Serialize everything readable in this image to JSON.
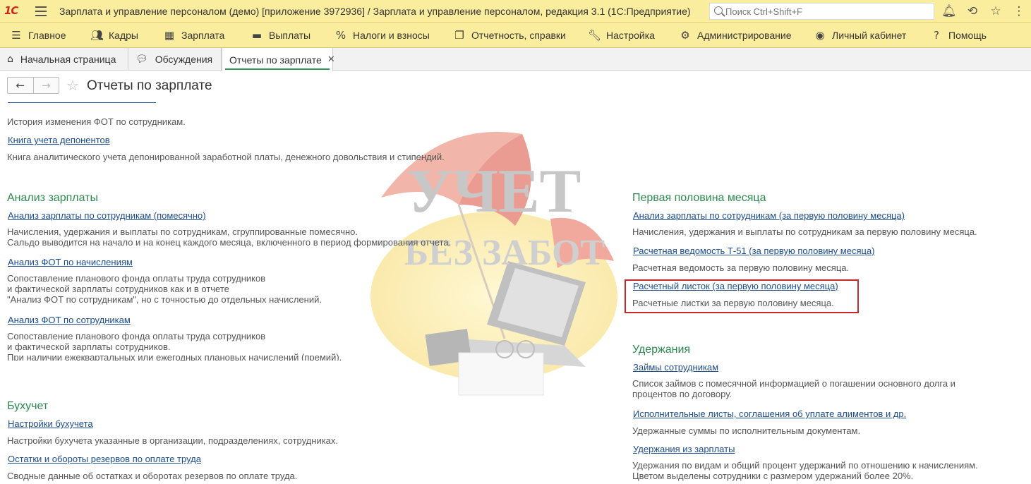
{
  "titlebar": {
    "app_title": "Зарплата и управление персоналом (демо) [приложение 3972936] / Зарплата и управление персоналом, редакция 3.1  (1С:Предприятие)",
    "search_placeholder": "Поиск Ctrl+Shift+F",
    "logo": "1С"
  },
  "menu": [
    {
      "label": "Главное",
      "icon": "hamburger-icon"
    },
    {
      "label": "Кадры",
      "icon": "people-icon"
    },
    {
      "label": "Зарплата",
      "icon": "calculator-icon"
    },
    {
      "label": "Выплаты",
      "icon": "wallet-icon"
    },
    {
      "label": "Налоги и взносы",
      "icon": "percent-icon"
    },
    {
      "label": "Отчетность, справки",
      "icon": "documents-icon"
    },
    {
      "label": "Настройка",
      "icon": "wrench-icon"
    },
    {
      "label": "Администрирование",
      "icon": "gear-icon"
    },
    {
      "label": "Личный кабинет",
      "icon": "user-circle-icon"
    },
    {
      "label": "Помощь",
      "icon": "question-icon"
    }
  ],
  "tabs": [
    {
      "label": "Начальная страница",
      "icon": "home-icon"
    },
    {
      "label": "Обсуждения",
      "icon": "chat-icon"
    },
    {
      "label": "Отчеты по зарплате",
      "active": true
    }
  ],
  "page": {
    "title": "Отчеты по зарплате"
  },
  "left": {
    "top": {
      "item1_desc": "История изменения ФОТ по сотрудникам.",
      "item2_link": "Книга учета депонентов",
      "item2_desc": "Книга аналитического учета депонированной заработной платы, денежного довольствия и стипендий."
    },
    "analysis": {
      "heading": "Анализ зарплаты",
      "link1": "Анализ зарплаты по сотрудникам (помесячно)",
      "desc1_l1": "Начисления, удержания и выплаты по сотрудникам, сгруппированные помесячно.",
      "desc1_l2": "Сальдо выводится на начало и на конец каждого месяца, включенного в период формирования отчета.",
      "link2": "Анализ ФОТ по начислениям",
      "desc2_l1": "Сопоставление планового фонда оплаты труда сотрудников",
      "desc2_l2": "и фактической зарплаты сотрудников как и в отчете",
      "desc2_l3": "\"Анализ ФОТ по сотрудникам\", но с точностью до отдельных начислений.",
      "link3": "Анализ ФОТ по сотрудникам",
      "desc3_l1": "Сопоставление планового фонда оплаты труда сотрудников",
      "desc3_l2": "и фактической зарплаты сотрудников.",
      "desc3_l3": "При наличии ежеквартальных или ежегодных плановых начислений (премий),"
    },
    "accounting": {
      "heading": "Бухучет",
      "link1": "Настройки бухучета",
      "desc1": "Настройки бухучета указанные в организации, подразделениях, сотрудниках.",
      "link2": "Остатки и обороты резервов по оплате труда",
      "desc2": "Сводные данные об остатках и оборотах резервов по оплате труда."
    }
  },
  "right": {
    "first_half": {
      "heading": "Первая половина месяца",
      "link1": "Анализ зарплаты по сотрудникам (за первую половину месяца)",
      "desc1": "Начисления, удержания и выплаты по сотрудникам за первую половину месяца.",
      "link2": "Расчетная ведомость Т-51 (за первую половину месяца)",
      "desc2": "Расчетная ведомость за первую половину месяца.",
      "link3": "Расчетный листок (за первую половину месяца)",
      "desc3": "Расчетные листки за первую половину месяца."
    },
    "deductions": {
      "heading": "Удержания",
      "link1": "Займы сотрудникам",
      "desc1_l1": "Список займов с помесячной информацией о погашении основного долга и",
      "desc1_l2": "процентов по договору.",
      "link2": "Исполнительные листы, соглашения об уплате алиментов и др.",
      "desc2": "Удержанные суммы по исполнительным документам.",
      "link3": "Удержания из зарплаты",
      "desc3_l1": "Удержания по видам и общий процент удержаний по отношению к начислениям.",
      "desc3_l2": "Цветом выделены сотрудники с размером удержаний более 20%."
    }
  },
  "watermark": {
    "line1": "УЧЕТ",
    "line2": "БЕЗ ЗАБОТ"
  },
  "colors": {
    "header_bg": "#fbed9e",
    "section_heading": "#2d8a4e",
    "link": "#1c4c8e",
    "highlight_border": "#c8282b"
  }
}
